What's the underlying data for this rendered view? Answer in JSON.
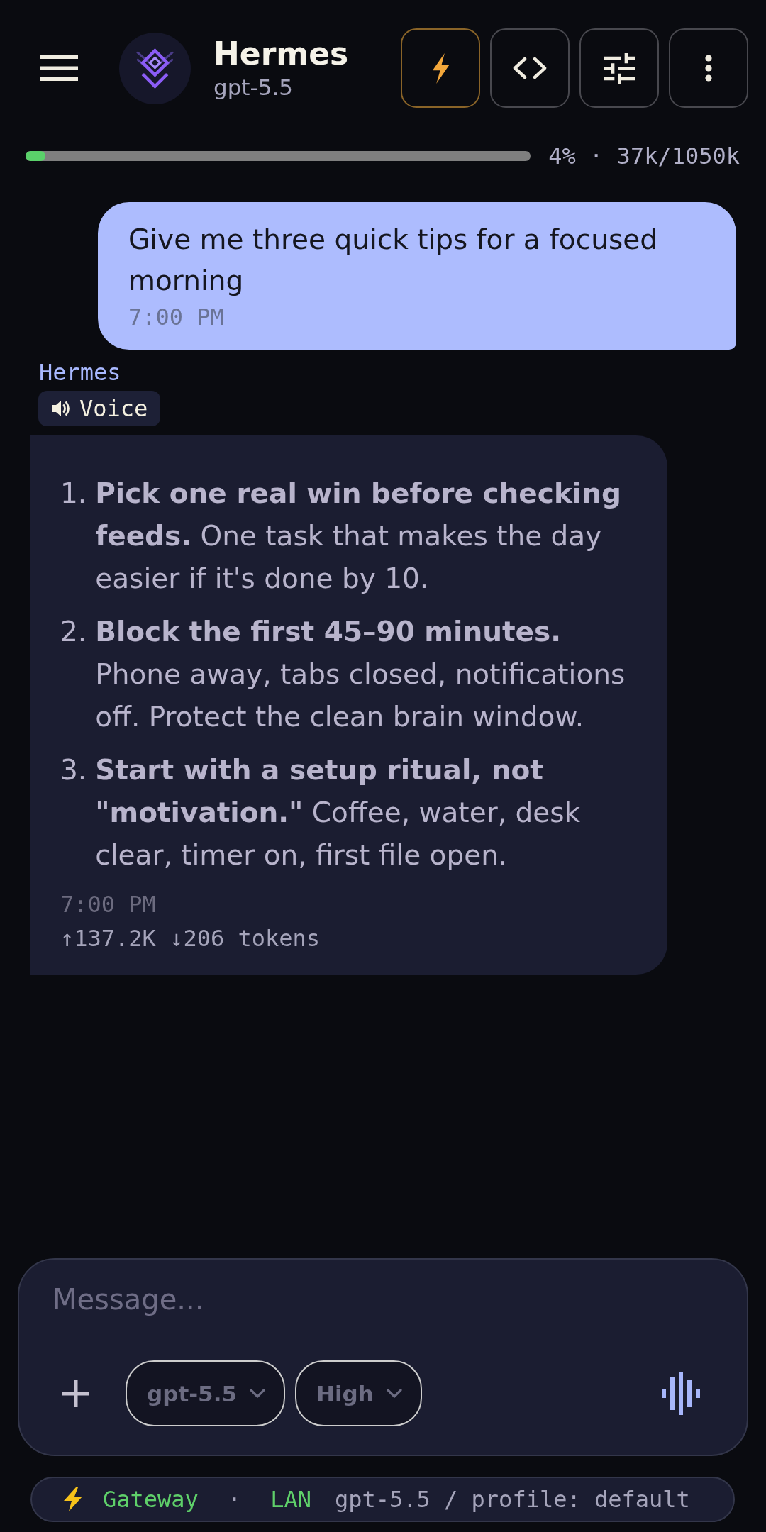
{
  "header": {
    "title": "Hermes",
    "subtitle": "gpt-5.5",
    "actions": [
      {
        "kind": "bolt",
        "highlighted": true
      },
      {
        "kind": "code",
        "highlighted": false
      },
      {
        "kind": "sliders",
        "highlighted": false
      },
      {
        "kind": "more",
        "highlighted": false
      }
    ]
  },
  "context_usage": {
    "level": 0.04,
    "label": "4% · 37k/1050k"
  },
  "messages": [
    {
      "kind": "user",
      "text": "Give me three quick tips for a focused morning",
      "time": "7:00 PM"
    },
    {
      "kind": "assistant",
      "sender": "Hermes",
      "badge": "Voice",
      "items": [
        {
          "number": "1.",
          "text": "**Pick one real win before checking feeds.** One task that makes the day easier if it's done by 10."
        },
        {
          "number": "2.",
          "text": "**Block the first 45–90 minutes.** Phone away, tabs closed, notifications off. Protect the clean brain window."
        },
        {
          "number": "3.",
          "text": "**Start with a setup ritual, not \"motivation.\"** Coffee, water, desk clear, timer on, first file open."
        }
      ],
      "time": "7:00 PM",
      "usage": "↑137.2K ↓206 tokens"
    }
  ],
  "composer": {
    "placeholder": "Message...",
    "model": "gpt-5.5",
    "effort": "High"
  },
  "status_bar": {
    "gateway": "Gateway",
    "separator": "·",
    "network": "LAN",
    "detail": "gpt-5.5 / profile: default"
  }
}
